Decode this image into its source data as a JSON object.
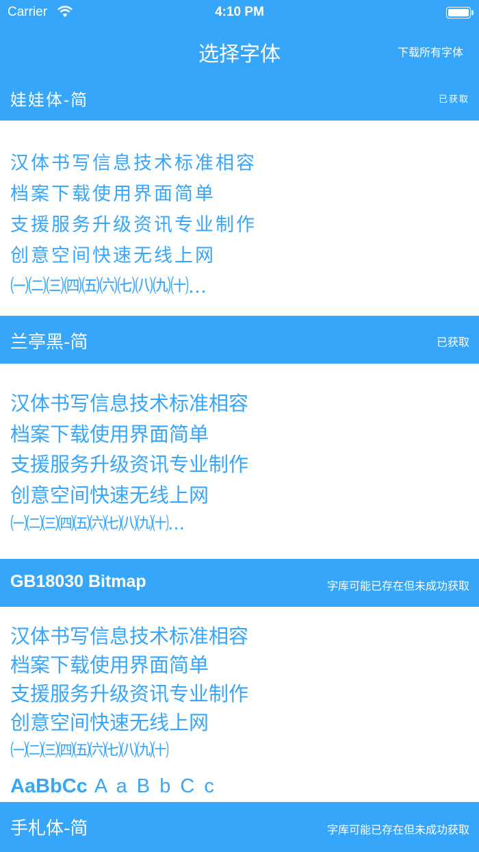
{
  "status_bar": {
    "carrier": "Carrier",
    "time": "4:10 PM"
  },
  "nav": {
    "title": "选择字体",
    "action": "下载所有字体"
  },
  "sections": [
    {
      "title": "娃娃体-简",
      "status": "已获取",
      "lines": [
        "汉体书写信息技术标准相容",
        "档案下载使用界面简单",
        "支援服务升级资讯专业制作",
        "创意空间快速无线上网",
        "㈠㈡㈢㈣㈤㈥㈦㈧㈨㈩…"
      ]
    },
    {
      "title": "兰亭黑-简",
      "status": "已获取",
      "lines": [
        "汉体书写信息技术标准相容",
        "档案下载使用界面简单",
        "支援服务升级资讯专业制作",
        "创意空间快速无线上网",
        "㈠㈡㈢㈣㈤㈥㈦㈧㈨㈩…"
      ]
    },
    {
      "title": "GB18030 Bitmap",
      "status": "字库可能已存在但未成功获取",
      "lines": [
        "汉体书写信息技术标准相容",
        "档案下载使用界面简单",
        "支援服务升级资讯专业制作",
        "创意空间快速无线上网",
        "㈠㈡㈢㈣㈤㈥㈦㈧㈨㈩"
      ],
      "latin_bold": "AaBbCc",
      "latin_spaced": "A a B b C c"
    },
    {
      "title": "手札体-简",
      "status": "字库可能已存在但未成功获取"
    }
  ],
  "colors": {
    "accent": "#36a6fb",
    "background": "#ffffff"
  }
}
